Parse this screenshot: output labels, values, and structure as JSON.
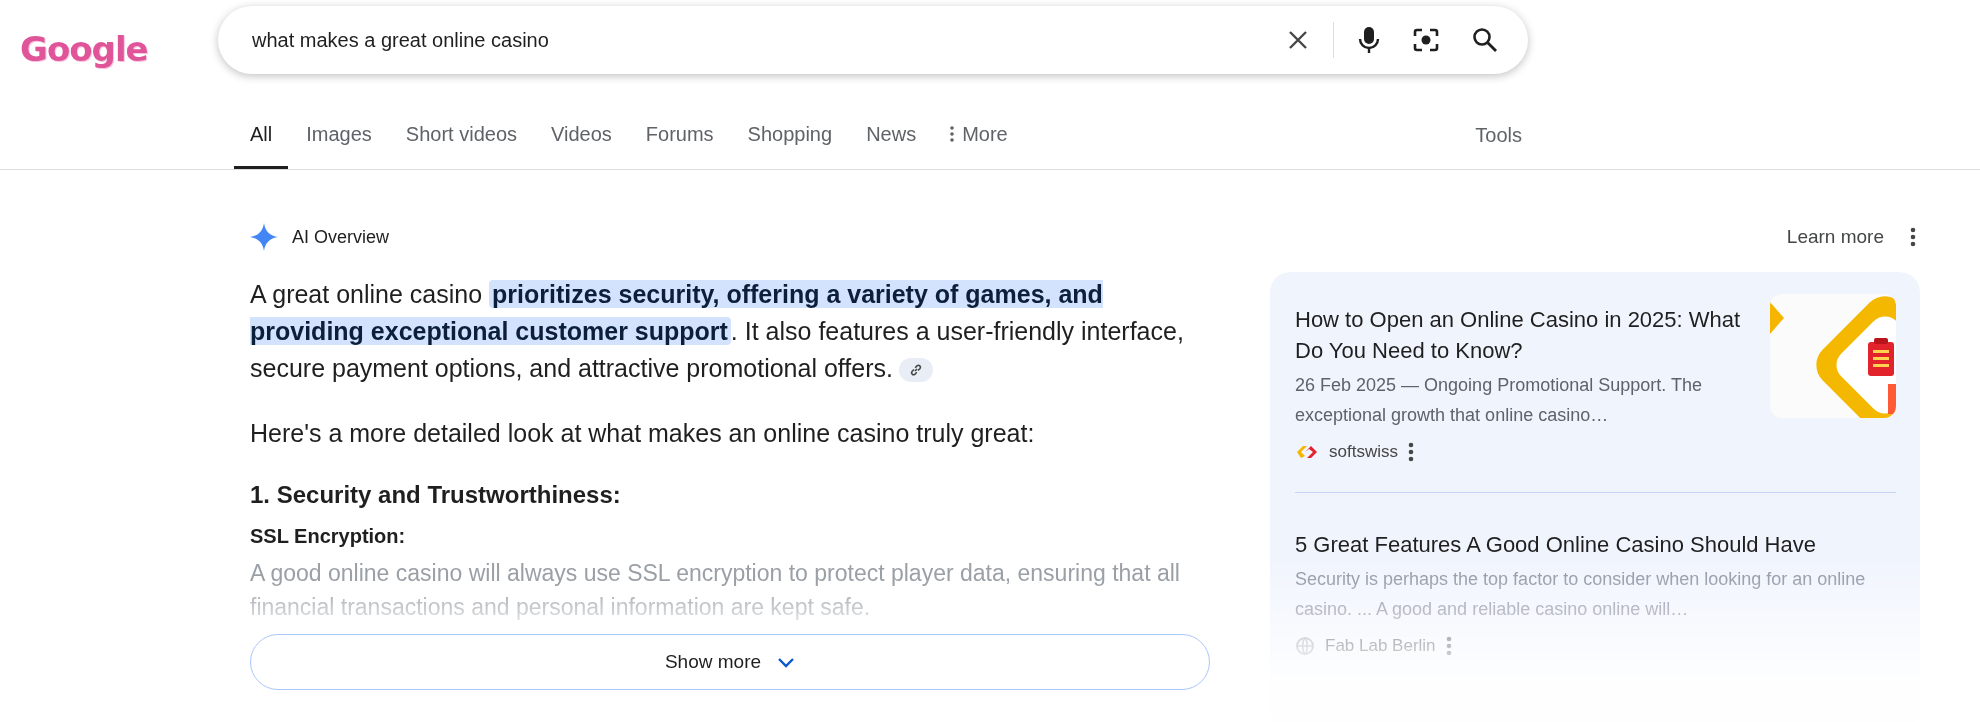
{
  "logo": {
    "text": "Google"
  },
  "search": {
    "value": "what makes a great online casino"
  },
  "tabs": [
    {
      "label": "All",
      "selected": true
    },
    {
      "label": "Images",
      "selected": false
    },
    {
      "label": "Short videos",
      "selected": false
    },
    {
      "label": "Videos",
      "selected": false
    },
    {
      "label": "Forums",
      "selected": false
    },
    {
      "label": "Shopping",
      "selected": false
    },
    {
      "label": "News",
      "selected": false
    },
    {
      "label": "More",
      "selected": false,
      "kind": "menu"
    }
  ],
  "tools": "Tools",
  "ai_overview": {
    "title": "AI Overview",
    "learn_more": "Learn more",
    "summary": "A great online casino **prioritizes security, offering a variety of games, and providing exceptional customer support**. It also features a user-friendly interface, secure payment options, and attractive promotional offers.",
    "intro": "Here's a more detailed look at what makes an online casino truly great:",
    "heading": "1. Security and Trustworthiness:",
    "subheading": "SSL Encryption:",
    "faded_text": "A good online casino will always use SSL encryption to protect player data, ensuring that all financial transactions and personal information are kept safe.",
    "show_more": "Show more"
  },
  "sources": [
    {
      "title": "How to Open an Online Casino in 2025: What Do You Need to Know?",
      "snippet": "26 Feb 2025 — Ongoing Promotional Support. The exceptional growth that online casino…",
      "source": "softswiss",
      "faded": false
    },
    {
      "title": "5 Great Features A Good Online Casino Should Have",
      "snippet": "Security is perhaps the top factor to consider when looking for an online casino. ... A good and reliable casino online will…",
      "source": "Fab Lab Berlin",
      "faded": true
    }
  ]
}
